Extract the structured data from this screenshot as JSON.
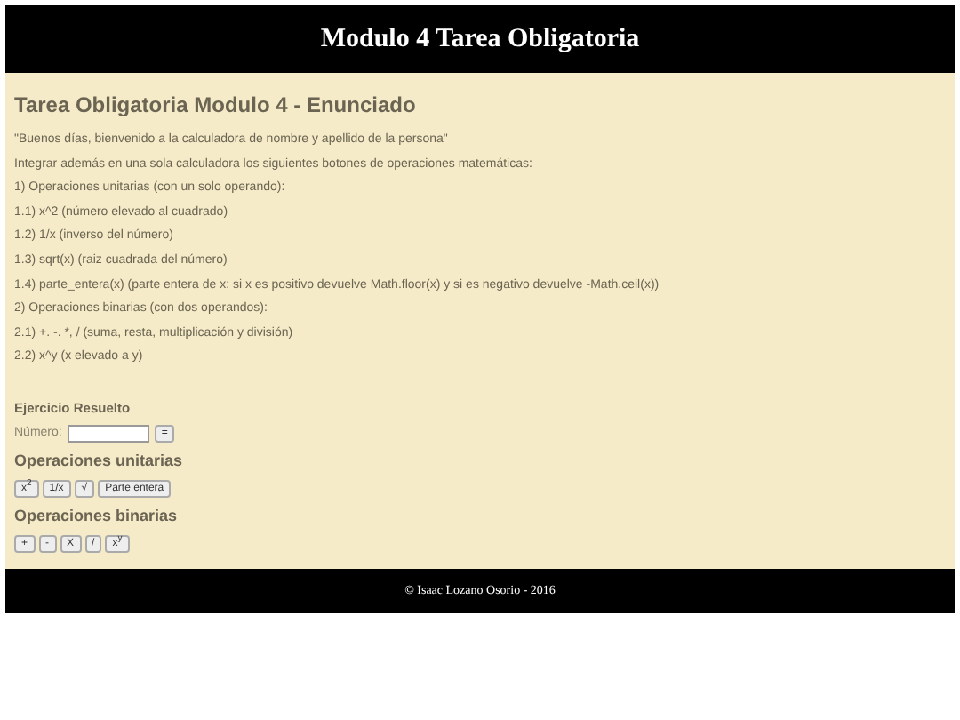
{
  "header": {
    "title": "Modulo 4 Tarea Obligatoria"
  },
  "statement": {
    "heading": "Tarea Obligatoria Modulo 4 - Enunciado",
    "paragraphs": [
      "\"Buenos días, bienvenido a la calculadora de nombre y apellido de la persona\"",
      "Integrar además en una sola calculadora los siguientes botones de operaciones matemáticas:",
      "1) Operaciones unitarias (con un solo operando):",
      "1.1) x^2 (número elevado al cuadrado)",
      "1.2) 1/x (inverso del número)",
      "1.3) sqrt(x) (raiz cuadrada del número)",
      "1.4) parte_entera(x) (parte entera de x: si x es positivo devuelve Math.floor(x) y si es negativo devuelve -Math.ceil(x))",
      "2) Operaciones binarias (con dos operandos):",
      "2.1) +. -. *, / (suma, resta, multiplicación y división)",
      "2.2) x^y (x elevado a y)"
    ]
  },
  "exercise": {
    "heading": "Ejercicio Resuelto",
    "number_label": "Número:",
    "equals_button": "=",
    "unary_heading": "Operaciones unitarias",
    "unary_buttons": [
      "x$^{2}$",
      "1/x",
      "√",
      "Parte entera"
    ],
    "binary_heading": "Operaciones binarias",
    "binary_buttons": [
      "+",
      "-",
      "X",
      "/",
      "x$^{y}$"
    ]
  },
  "footer": {
    "text": "© Isaac Lozano Osorio - 2016"
  }
}
